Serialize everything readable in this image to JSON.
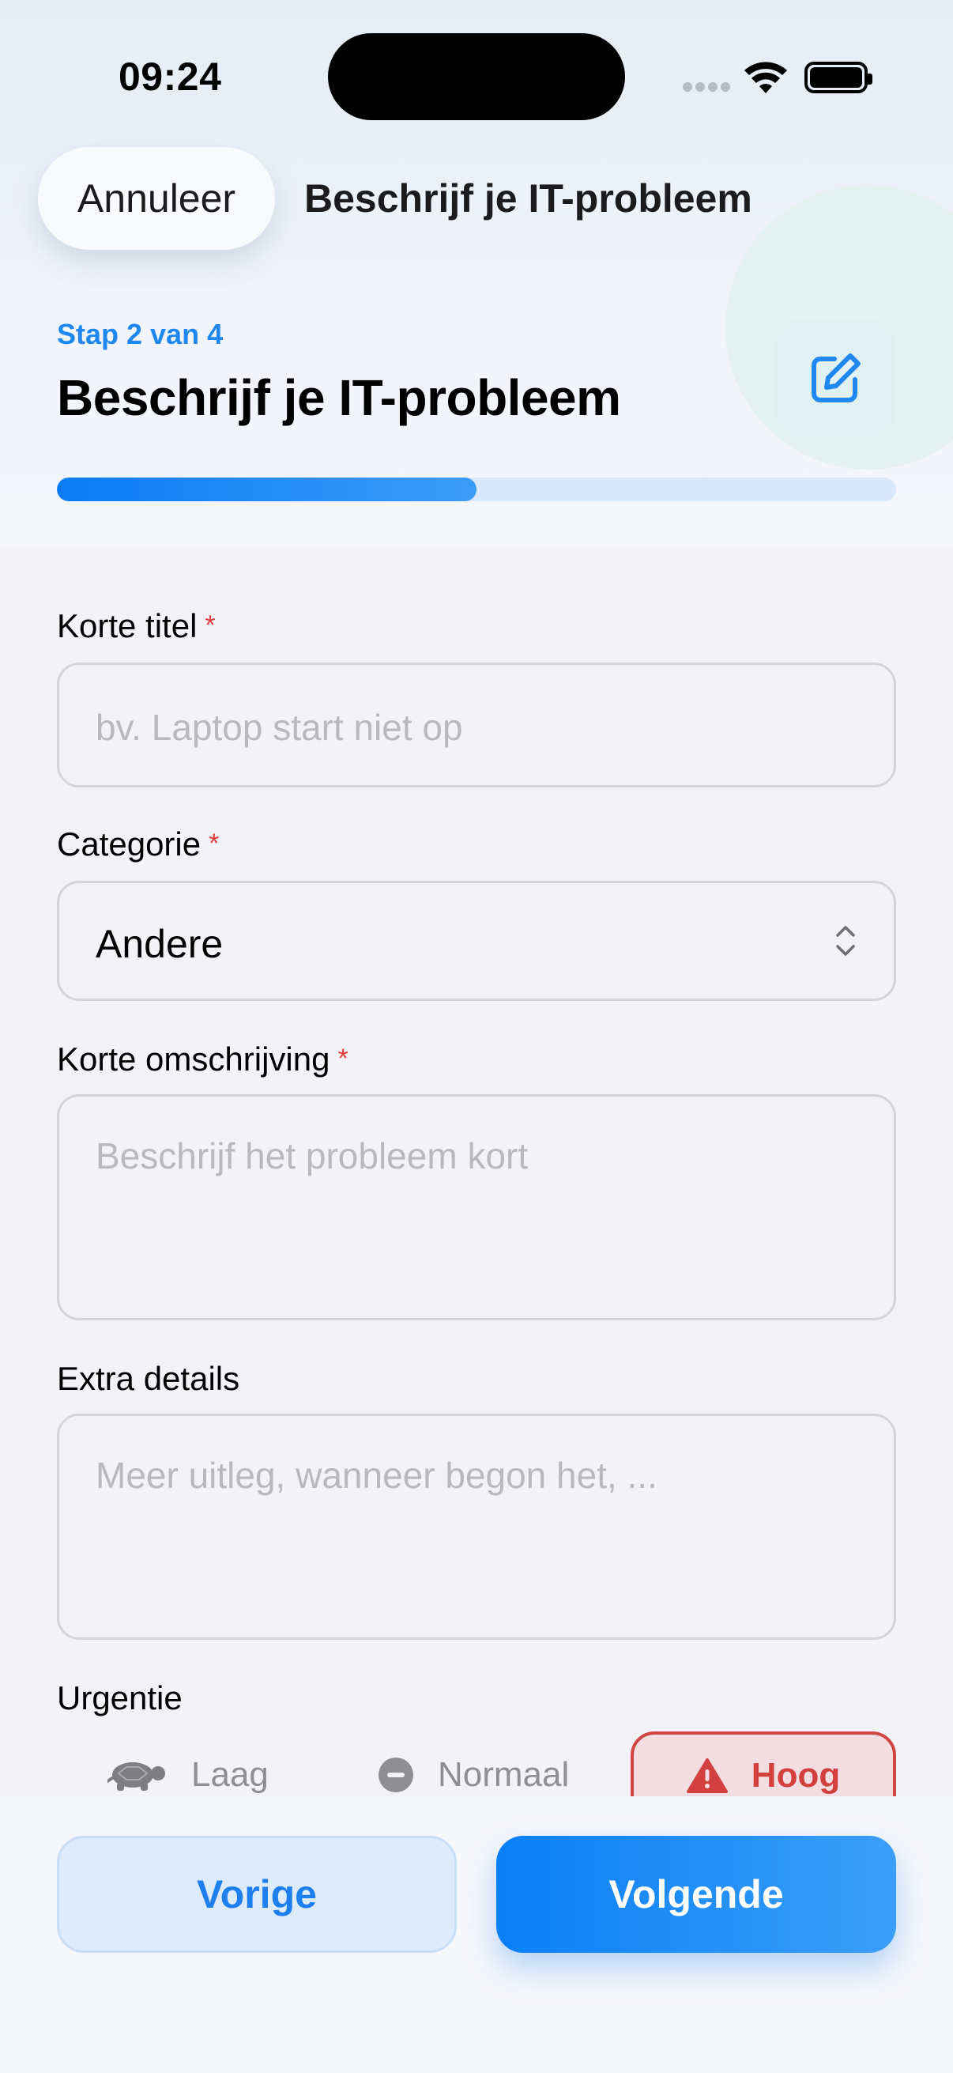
{
  "status_bar": {
    "time": "09:24"
  },
  "nav": {
    "cancel_label": "Annuleer",
    "title": "Beschrijf je IT-probleem"
  },
  "header": {
    "step_label": "Stap 2 van 4",
    "title": "Beschrijf je IT-probleem",
    "progress_fraction": 0.5,
    "edit_icon": "square-and-pencil-icon"
  },
  "form": {
    "title_field": {
      "label": "Korte titel",
      "required_mark": "*",
      "placeholder": "bv. Laptop start niet op",
      "value": ""
    },
    "category_field": {
      "label": "Categorie",
      "required_mark": "*",
      "selected": "Andere"
    },
    "description_field": {
      "label": "Korte omschrijving",
      "required_mark": "*",
      "placeholder": "Beschrijf het probleem kort",
      "value": ""
    },
    "details_field": {
      "label": "Extra details",
      "placeholder": "Meer uitleg, wanneer begon het, ...",
      "value": ""
    },
    "urgency": {
      "label": "Urgentie",
      "options": [
        {
          "label": "Laag",
          "icon": "tortoise-icon"
        },
        {
          "label": "Normaal",
          "icon": "minus-circle-icon"
        },
        {
          "label": "Hoog",
          "icon": "warning-triangle-icon"
        }
      ],
      "selected": "Hoog"
    }
  },
  "footer": {
    "previous_label": "Vorige",
    "next_label": "Volgende"
  },
  "colors": {
    "accent": "#1e87f0",
    "danger": "#d24040",
    "background": "#f2f2f7"
  }
}
